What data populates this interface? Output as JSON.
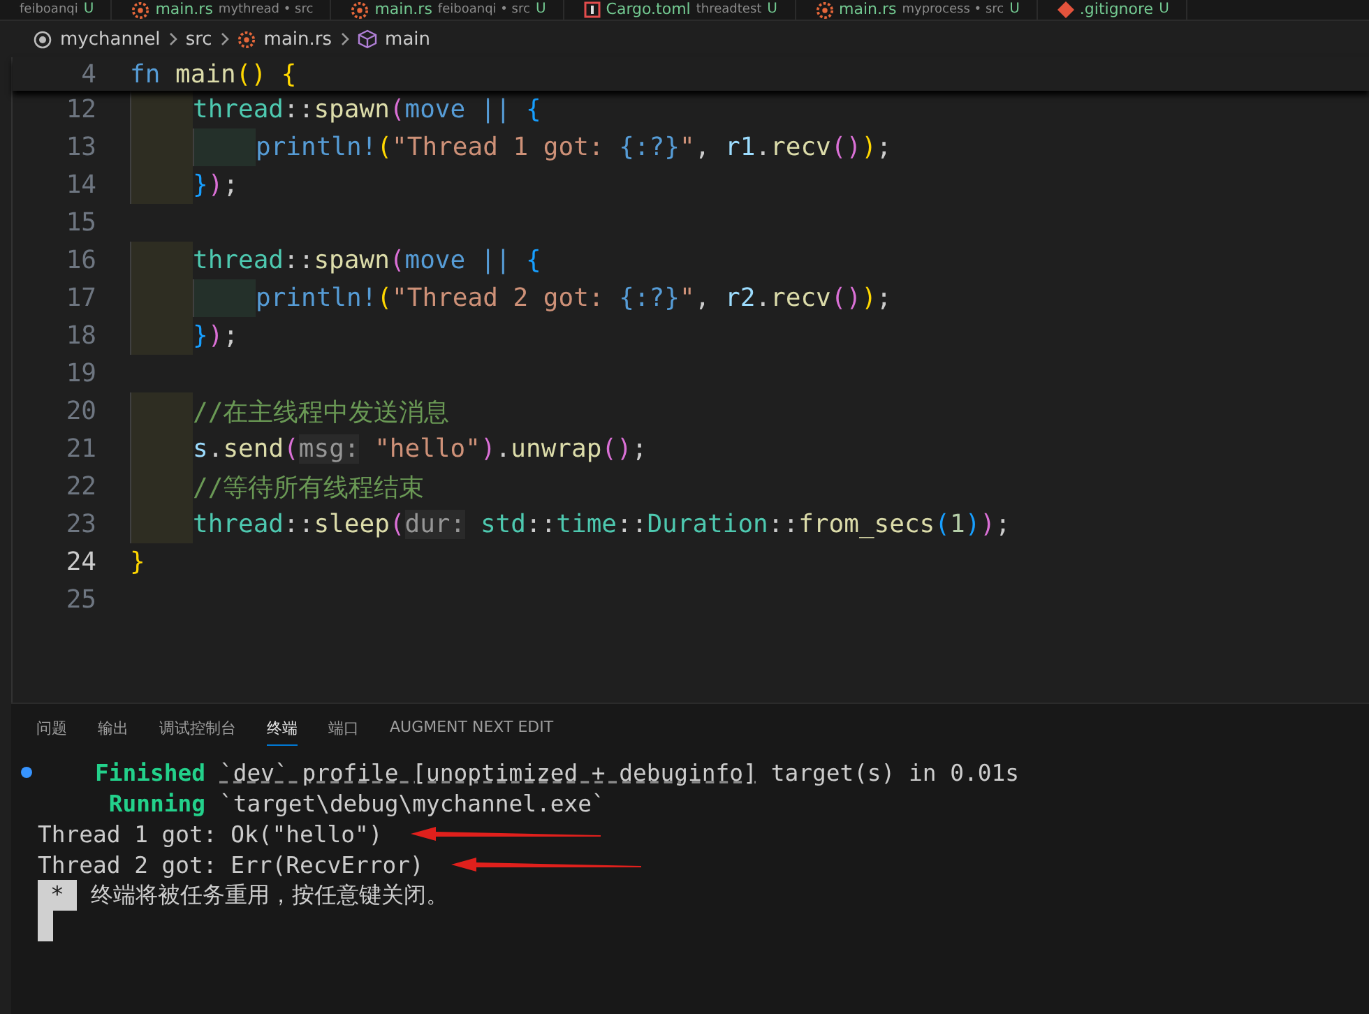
{
  "tabs": [
    {
      "kind": "plain",
      "description": "feiboanqi",
      "status": "U"
    },
    {
      "kind": "source",
      "name": "main.rs",
      "description": "mythread • src"
    },
    {
      "kind": "source",
      "name": "main.rs",
      "description": "feiboanqi • src",
      "status": "U"
    },
    {
      "kind": "manifest",
      "name": "Cargo.toml",
      "description": "threadtest",
      "status": "U"
    },
    {
      "kind": "source",
      "name": "main.rs",
      "description": "myprocess • src",
      "status": "U"
    },
    {
      "kind": "ignore",
      "name": ".gitignore",
      "status": "U"
    }
  ],
  "breadcrumb": [
    "mychannel",
    "src",
    "main.rs",
    "main"
  ],
  "sticky_line": {
    "number": "4",
    "tokens": [
      {
        "kind": "kw",
        "text": "fn"
      },
      {
        "kind": "fn",
        "text": " main"
      },
      {
        "kind": "b1",
        "text": "()"
      },
      {
        "kind": "b1",
        "text": " {"
      }
    ]
  },
  "code_lines": [
    {
      "number": "12",
      "current": false,
      "kind": "body",
      "tokens": [
        {
          "kind": "ns",
          "text": "thread"
        },
        {
          "kind": "p",
          "text": "::"
        },
        {
          "kind": "fn",
          "text": "spawn"
        },
        {
          "kind": "b2",
          "text": "("
        },
        {
          "kind": "kw",
          "text": "move ||"
        },
        {
          "kind": "b3",
          "text": " {"
        }
      ]
    },
    {
      "number": "13",
      "current": false,
      "kind": "inner",
      "tokens": [
        {
          "kind": "macro",
          "text": "println!"
        },
        {
          "kind": "b1",
          "text": "("
        },
        {
          "kind": "str",
          "text": "\"Thread 1 got: "
        },
        {
          "kind": "kw",
          "text": "{:?}"
        },
        {
          "kind": "str",
          "text": "\""
        },
        {
          "kind": "p",
          "text": ", "
        },
        {
          "kind": "var",
          "text": "r1"
        },
        {
          "kind": "p",
          "text": "."
        },
        {
          "kind": "fn",
          "text": "recv"
        },
        {
          "kind": "b2",
          "text": "()"
        },
        {
          "kind": "b1",
          "text": ")"
        },
        {
          "kind": "p",
          "text": ";"
        }
      ]
    },
    {
      "number": "14",
      "current": false,
      "kind": "body",
      "tokens": [
        {
          "kind": "b3",
          "text": "}"
        },
        {
          "kind": "b2",
          "text": ")"
        },
        {
          "kind": "p",
          "text": ";"
        }
      ]
    },
    {
      "number": "15",
      "current": false,
      "kind": "blank"
    },
    {
      "number": "16",
      "current": false,
      "kind": "body",
      "tokens": [
        {
          "kind": "ns",
          "text": "thread"
        },
        {
          "kind": "p",
          "text": "::"
        },
        {
          "kind": "fn",
          "text": "spawn"
        },
        {
          "kind": "b2",
          "text": "("
        },
        {
          "kind": "kw",
          "text": "move ||"
        },
        {
          "kind": "b3",
          "text": " {"
        }
      ]
    },
    {
      "number": "17",
      "current": false,
      "kind": "inner",
      "tokens": [
        {
          "kind": "macro",
          "text": "println!"
        },
        {
          "kind": "b1",
          "text": "("
        },
        {
          "kind": "str",
          "text": "\"Thread 2 got: "
        },
        {
          "kind": "kw",
          "text": "{:?}"
        },
        {
          "kind": "str",
          "text": "\""
        },
        {
          "kind": "p",
          "text": ", "
        },
        {
          "kind": "var",
          "text": "r2"
        },
        {
          "kind": "p",
          "text": "."
        },
        {
          "kind": "fn",
          "text": "recv"
        },
        {
          "kind": "b2",
          "text": "()"
        },
        {
          "kind": "b1",
          "text": ")"
        },
        {
          "kind": "p",
          "text": ";"
        }
      ]
    },
    {
      "number": "18",
      "current": false,
      "kind": "body",
      "tokens": [
        {
          "kind": "b3",
          "text": "}"
        },
        {
          "kind": "b2",
          "text": ")"
        },
        {
          "kind": "p",
          "text": ";"
        }
      ]
    },
    {
      "number": "19",
      "current": false,
      "kind": "blank"
    },
    {
      "number": "20",
      "current": false,
      "kind": "body",
      "tokens": [
        {
          "kind": "comment",
          "text": "//在主线程中发送消息"
        }
      ]
    },
    {
      "number": "21",
      "current": false,
      "kind": "body",
      "tokens": [
        {
          "kind": "var",
          "text": "s"
        },
        {
          "kind": "p",
          "text": "."
        },
        {
          "kind": "fn",
          "text": "send"
        },
        {
          "kind": "b2",
          "text": "("
        },
        {
          "kind": "hint",
          "text": "msg:"
        },
        {
          "kind": "str",
          "text": " \"hello\""
        },
        {
          "kind": "b2",
          "text": ")"
        },
        {
          "kind": "p",
          "text": "."
        },
        {
          "kind": "fn",
          "text": "unwrap"
        },
        {
          "kind": "b2",
          "text": "()"
        },
        {
          "kind": "p",
          "text": ";"
        }
      ]
    },
    {
      "number": "22",
      "current": false,
      "kind": "body",
      "tokens": [
        {
          "kind": "comment",
          "text": "//等待所有线程结束"
        }
      ]
    },
    {
      "number": "23",
      "current": false,
      "kind": "body",
      "tokens": [
        {
          "kind": "ns",
          "text": "thread"
        },
        {
          "kind": "p",
          "text": "::"
        },
        {
          "kind": "fn",
          "text": "sleep"
        },
        {
          "kind": "b2",
          "text": "("
        },
        {
          "kind": "hint",
          "text": "dur:"
        },
        {
          "kind": "ns",
          "text": " std"
        },
        {
          "kind": "p",
          "text": "::"
        },
        {
          "kind": "ns",
          "text": "time"
        },
        {
          "kind": "p",
          "text": "::"
        },
        {
          "kind": "type",
          "text": "Duration"
        },
        {
          "kind": "p",
          "text": "::"
        },
        {
          "kind": "fn",
          "text": "from_secs"
        },
        {
          "kind": "b3",
          "text": "("
        },
        {
          "kind": "num",
          "text": "1"
        },
        {
          "kind": "b3",
          "text": ")"
        },
        {
          "kind": "b2",
          "text": ")"
        },
        {
          "kind": "p",
          "text": ";"
        }
      ]
    },
    {
      "number": "24",
      "current": true,
      "kind": "top",
      "tokens": [
        {
          "kind": "b1",
          "text": "}"
        }
      ]
    },
    {
      "number": "25",
      "current": false,
      "kind": "blank"
    }
  ],
  "panel_tabs": [
    {
      "label": "问题",
      "selected": false
    },
    {
      "label": "输出",
      "selected": false
    },
    {
      "label": "调试控制台",
      "selected": false
    },
    {
      "label": "终端",
      "selected": true
    },
    {
      "label": "端口",
      "selected": false
    },
    {
      "label": "AUGMENT NEXT EDIT",
      "selected": false
    }
  ],
  "terminal_lines": [
    {
      "marker": true,
      "arrow": false,
      "segments": [
        {
          "kind": "green",
          "text": "Finished"
        },
        {
          "kind": "link",
          "text": "`dev` profile [unoptimized + debuginfo]"
        },
        {
          "kind": "plain",
          "text": "target(s) in 0.01s"
        }
      ]
    },
    {
      "marker": false,
      "arrow": false,
      "segments": [
        {
          "kind": "green",
          "text": "Running"
        },
        {
          "kind": "plain",
          "text": "`target\\debug\\mychannel.exe`"
        }
      ]
    },
    {
      "marker": false,
      "arrow": true,
      "segments": [
        {
          "kind": "plain",
          "text": "Thread 1 got: Ok(\"hello\")"
        }
      ]
    },
    {
      "marker": false,
      "arrow": true,
      "segments": [
        {
          "kind": "plain",
          "text": "Thread 2 got: Err(RecvError)"
        }
      ]
    }
  ],
  "terminal_notice": {
    "badge": "*",
    "text": "终端将被任务重用，按任意键关闭。"
  }
}
